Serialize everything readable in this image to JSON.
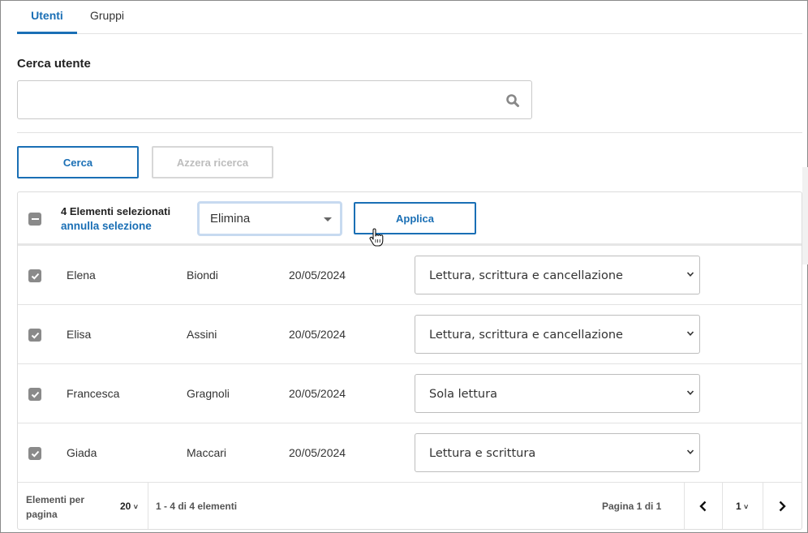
{
  "tabs": [
    {
      "label": "Utenti",
      "active": true
    },
    {
      "label": "Gruppi",
      "active": false
    }
  ],
  "search": {
    "label": "Cerca utente",
    "value": "",
    "placeholder": "",
    "icon": "search-icon"
  },
  "buttons": {
    "search": "Cerca",
    "reset": "Azzera ricerca",
    "apply": "Applica"
  },
  "bulk": {
    "selected_text": "4 Elementi selezionati",
    "cancel_text": "annulla selezione",
    "action_value": "Elimina"
  },
  "rows": [
    {
      "first": "Elena",
      "last": "Biondi",
      "date": "20/05/2024",
      "permission": "Lettura, scrittura e cancellazione",
      "checked": true
    },
    {
      "first": "Elisa",
      "last": "Assini",
      "date": "20/05/2024",
      "permission": "Lettura, scrittura e cancellazione",
      "checked": true
    },
    {
      "first": "Francesca",
      "last": "Gragnoli",
      "date": "20/05/2024",
      "permission": "Sola lettura",
      "checked": true
    },
    {
      "first": "Giada",
      "last": "Maccari",
      "date": "20/05/2024",
      "permission": "Lettura e scrittura",
      "checked": true
    }
  ],
  "pagination": {
    "per_page_label": "Elementi per pagina",
    "per_page_value": "20",
    "range_text": "1 - 4 di 4 elementi",
    "page_of_text": "Pagina 1 di 1",
    "current_page": "1"
  },
  "colors": {
    "accent": "#1a6fb5",
    "checkbox": "#8a8a8a",
    "disabled": "#bdbdbd"
  }
}
